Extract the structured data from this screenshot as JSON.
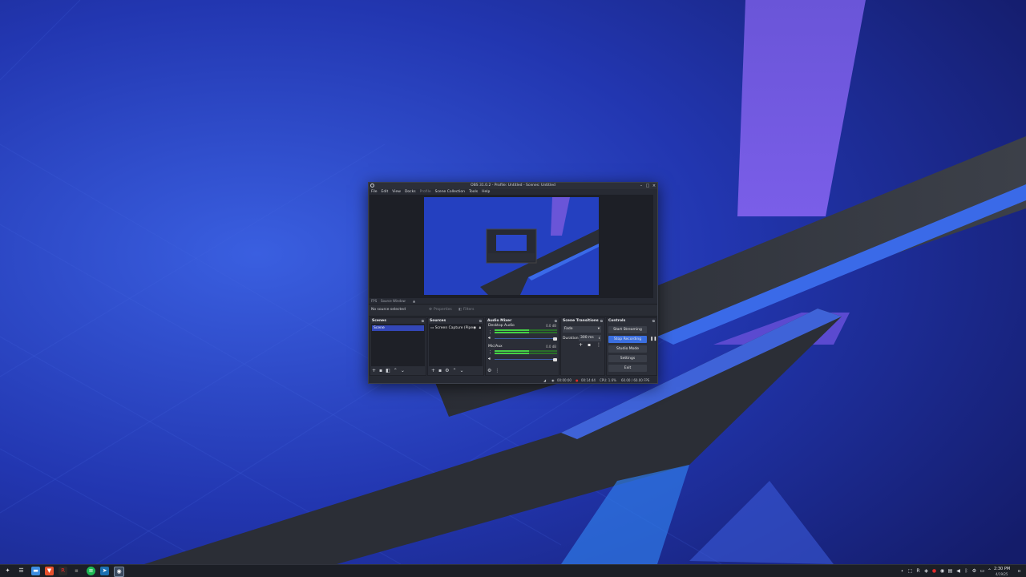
{
  "window": {
    "title": "OBS 31.0.2 - Profile: Untitled - Scenes: Untitled"
  },
  "menu": [
    "File",
    "Edit",
    "View",
    "Docks",
    "Profile",
    "Scene Collection",
    "Tools",
    "Help"
  ],
  "source_toolbar": {
    "fps_label": "FPS",
    "source_name": "Source Window"
  },
  "properties_bar": {
    "no_source": "No source selected",
    "properties": "Properties",
    "filters": "Filters"
  },
  "scenes": {
    "title": "Scenes",
    "items": [
      "Scene"
    ]
  },
  "sources": {
    "title": "Sources",
    "items": [
      "Screen Capture (Pipe"
    ]
  },
  "audio_mixer": {
    "title": "Audio Mixer",
    "channels": [
      {
        "name": "Desktop Audio",
        "db": "0.0 dB",
        "level": 0.55,
        "volume": 1.0
      },
      {
        "name": "Mic/Aux",
        "db": "0.0 dB",
        "level": 0.55,
        "volume": 1.0
      }
    ]
  },
  "transitions": {
    "title": "Scene Transitions",
    "type": "Fade",
    "duration_label": "Duration",
    "duration_value": "300 ms"
  },
  "controls": {
    "title": "Controls",
    "start_streaming": "Start Streaming",
    "stop_recording": "Stop Recording",
    "studio_mode": "Studio Mode",
    "settings": "Settings",
    "exit": "Exit"
  },
  "statusbar": {
    "stream_time": "00:00:00",
    "rec_time": "00:14:44",
    "cpu": "CPU: 1.6%",
    "fps": "60.00 / 60.00 FPS"
  },
  "taskbar": {
    "time": "2:30 PM",
    "date": "4/19/25"
  },
  "colors": {
    "accent": "#3b6fe0",
    "window_bg": "#272a33",
    "record_red": "#e02a2a"
  }
}
